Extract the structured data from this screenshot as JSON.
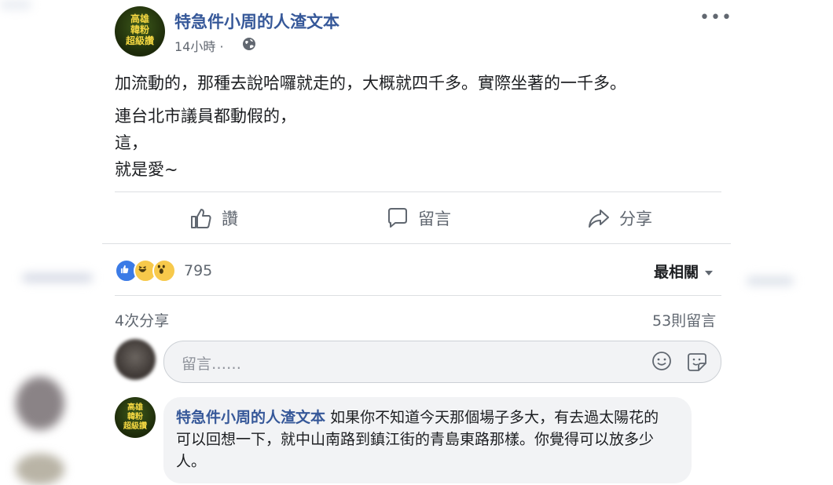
{
  "post": {
    "author": "特急件小周的人渣文本",
    "avatar_text": [
      "高雄",
      "韓粉",
      "超級讚"
    ],
    "timestamp": "14小時 ·",
    "body_lines": [
      "加流動的，那種去說哈囉就走的，大概就四千多。實際坐著的一千多。",
      "連台北市議員都動假的，",
      "這，",
      "就是愛~"
    ]
  },
  "actions": {
    "like": "讚",
    "comment": "留言",
    "share": "分享"
  },
  "stats": {
    "reaction_count": "795",
    "sort_label": "最相關",
    "shares": "4次分享",
    "comments": "53則留言"
  },
  "comment_input": {
    "placeholder": "留言……"
  },
  "reply": {
    "author": "特急件小周的人渣文本",
    "text": "如果你不知道今天那個場子多大，有去過太陽花的可以回想一下，就中山南路到鎮江街的青島東路那樣。你覺得可以放多少人。"
  },
  "colors": {
    "link": "#365899",
    "secondary_text": "#616770",
    "like_blue": "#3b7be6",
    "emoji_yellow": "#f7c94b"
  }
}
